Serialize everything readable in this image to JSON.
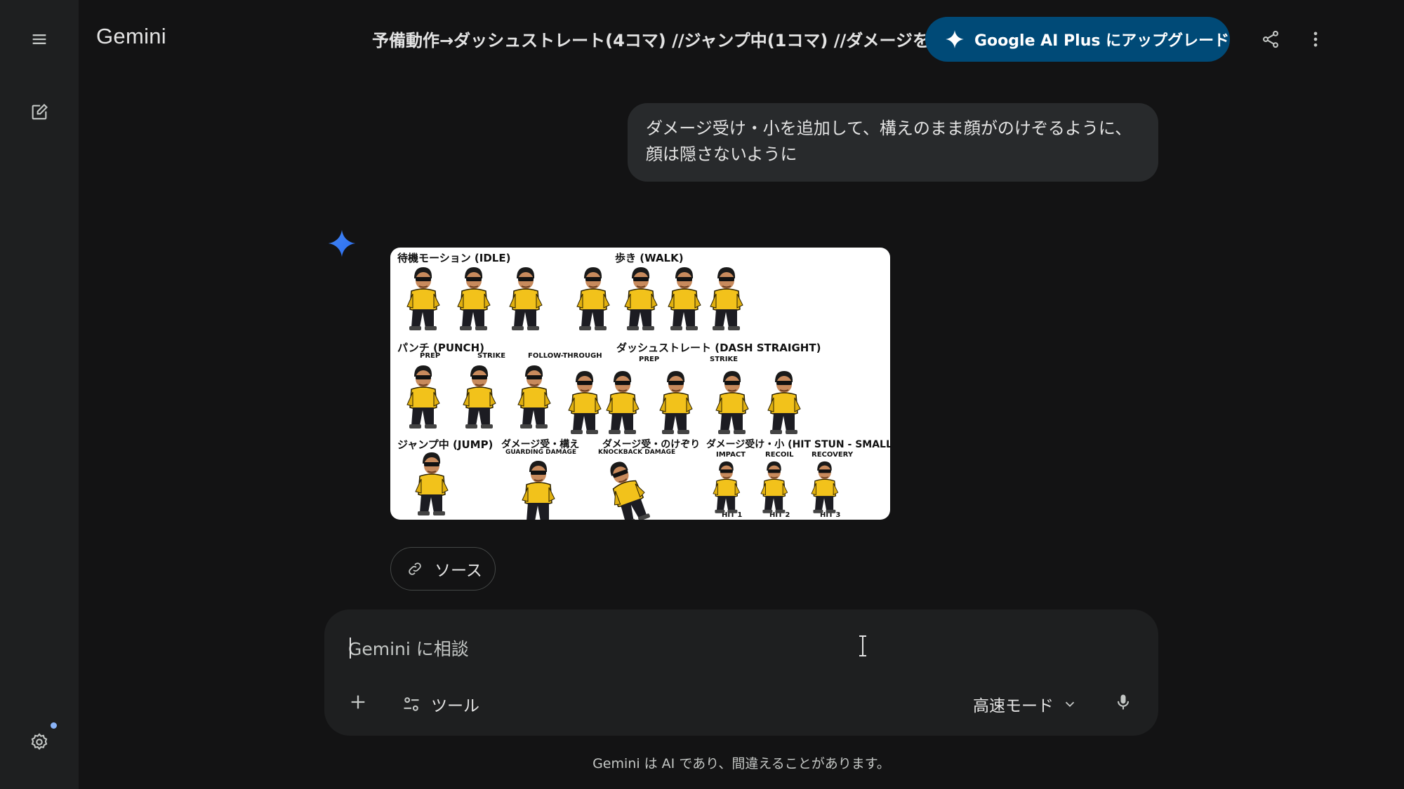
{
  "sidebar": {
    "menu_icon": "hamburger-menu-icon",
    "new_chat_icon": "edit-square-icon",
    "settings_icon": "gear-icon"
  },
  "header": {
    "app_title": "Gemini",
    "chat_title": "予備動作→ダッシュストレート(4コマ) //ジャンプ中(1コマ) //ダメージを",
    "upgrade_label": "Google AI Plus にアップグレード",
    "share_icon": "share-icon",
    "more_icon": "more-vertical-icon",
    "accent_color": "#004a77"
  },
  "conversation": {
    "user_message": "ダメージ受け・小を追加して、構えのまま顔がのけぞるように、顔は隠さないように",
    "sheet": {
      "idle": "待機モーション (IDLE)",
      "walk": "歩き (WALK)",
      "punch": "パンチ (PUNCH)",
      "prep": "PREP",
      "strike": "STRIKE",
      "follow": "FOLLOW-THROUGH",
      "dash": "ダッシュストレート (DASH STRAIGHT)",
      "prep2": "PREP",
      "strike2": "STRIKE",
      "jump": "ジャンプ中 (JUMP)",
      "guard": "ダメージ受・構え",
      "guard_en": "GUARDING DAMAGE",
      "knock": "ダメージ受・のけぞり",
      "knock_en": "KNOCKBACK DAMAGE",
      "hitstun": "ダメージ受け・小 (HIT STUN - SMALL)",
      "impact": "IMPACT",
      "recoil": "RECOIL",
      "recovery": "RECOVERY",
      "hit1": "HIT 1",
      "hit2": "HIT 2",
      "hit3": "HIT 3"
    },
    "source_label": "ソース"
  },
  "input": {
    "placeholder": "Gemini に相談",
    "tools_label": "ツール",
    "mode_label": "高速モード"
  },
  "footer": {
    "disclaimer": "Gemini は AI であり、間違えることがあります。"
  }
}
